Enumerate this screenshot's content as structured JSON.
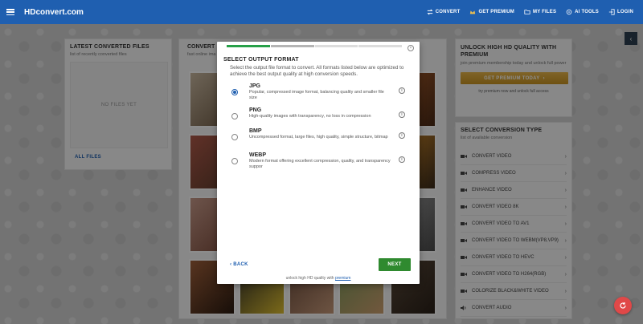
{
  "header": {
    "logo": "HDconvert.com",
    "nav": [
      {
        "label": "CONVERT",
        "icon": "convert-icon"
      },
      {
        "label": "GET PREMIUM",
        "icon": "crown-icon"
      },
      {
        "label": "MY FILES",
        "icon": "folder-icon"
      },
      {
        "label": "AI TOOLS",
        "icon": "ai-icon"
      },
      {
        "label": "LOGIN",
        "icon": "login-icon"
      }
    ]
  },
  "left_panel": {
    "title": "LATEST CONVERTED FILES",
    "subtitle": "list of recently converted files",
    "empty_text": "NO FILES YET",
    "all_files_label": "ALL FILES"
  },
  "middle_panel": {
    "title": "CONVERT",
    "subtitle": "fast online ima"
  },
  "right_panel": {
    "premium_title": "UNLOCK HIGH HD QUALITY WITH PREMIUM",
    "premium_subtitle": "join premium membership today and unlock full power",
    "premium_button": "GET PREMIUM TODAY",
    "premium_note": "try premium now and unlock full access",
    "conversion_title": "SELECT CONVERSION TYPE",
    "conversion_subtitle": "list of available conversion",
    "conversions": [
      {
        "label": "CONVERT VIDEO"
      },
      {
        "label": "COMPRESS VIDEO"
      },
      {
        "label": "ENHANCE VIDEO"
      },
      {
        "label": "CONVERT VIDEO 8K"
      },
      {
        "label": "CONVERT VIDEO TO AV1"
      },
      {
        "label": "CONVERT VIDEO TO WEBM(VP8,VP9)"
      },
      {
        "label": "CONVERT VIDEO TO HEVC"
      },
      {
        "label": "CONVERT VIDEO TO H264(RGB)"
      },
      {
        "label": "COLORIZE BLACK&WHITE VIDEO"
      },
      {
        "label": "CONVERT AUDIO"
      }
    ]
  },
  "modal": {
    "progress_steps": 4,
    "progress_done": 1,
    "title": "SELECT OUTPUT FORMAT",
    "description": "Select the output file format to convert. All formats listed below are optimized to achieve the best output quality at high conversion speeds.",
    "options": [
      {
        "name": "JPG",
        "desc": "Popular, compressed image format, balancing quality and smaller file size",
        "selected": true
      },
      {
        "name": "PNG",
        "desc": "High-quality images with transparency, no loss in compression",
        "selected": false
      },
      {
        "name": "BMP",
        "desc": "Uncompressed format, large files, high quality, simple structure, bitmap",
        "selected": false
      },
      {
        "name": "WEBP",
        "desc": "Modern format offering excellent compression, quality, and transparency suppor",
        "selected": false
      }
    ],
    "back_label": "BACK",
    "next_label": "NEXT",
    "unlock_text": "unlock high HD quality with",
    "unlock_link": "premium"
  },
  "colors": {
    "brand": "#1f5fb0",
    "next_button": "#2f8a2f",
    "progress_done": "#27a048",
    "premium_button": "#d6a536",
    "fab": "#e04848"
  }
}
